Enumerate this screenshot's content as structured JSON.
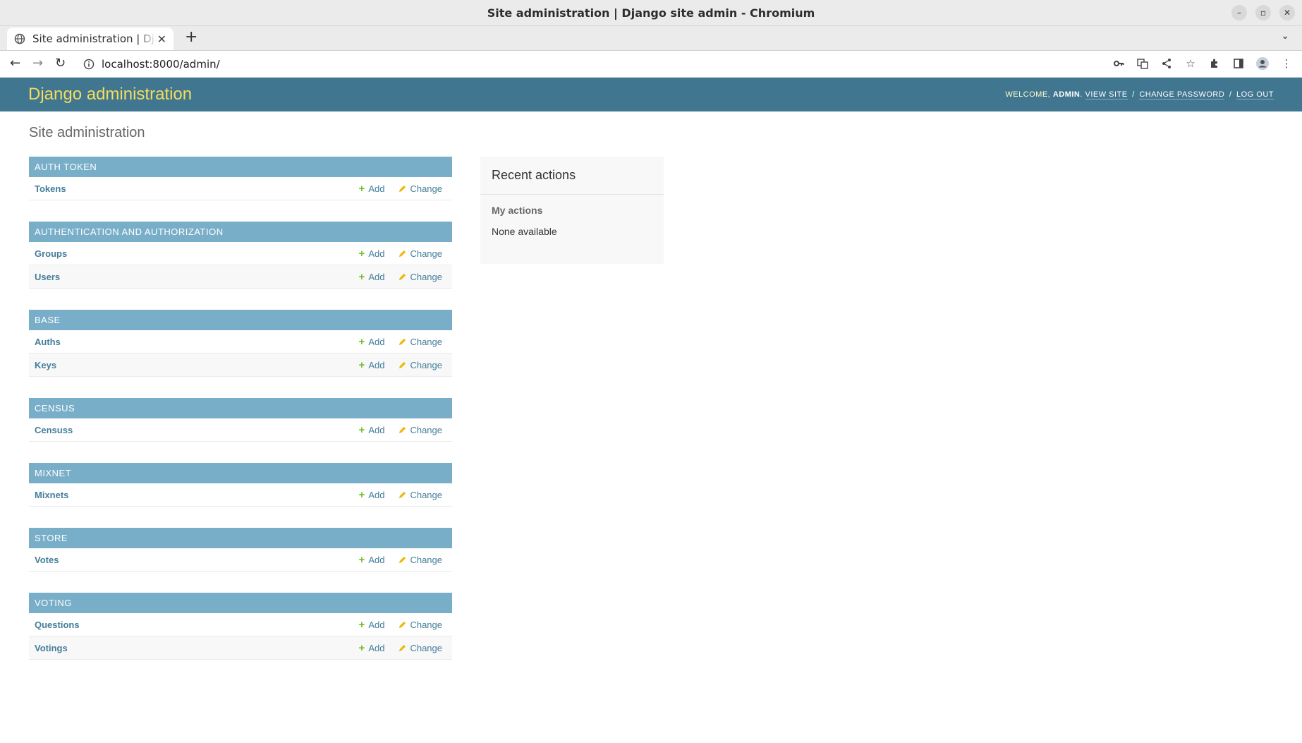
{
  "window": {
    "title": "Site administration | Django site admin - Chromium",
    "controls": [
      "–",
      "▫",
      "✕"
    ]
  },
  "tab": {
    "label": "Site administration | Django site admin",
    "close": "✕",
    "new_tab": "+"
  },
  "toolbar": {
    "url": "localhost:8000/admin/",
    "back": "←",
    "forward": "→",
    "reload": "↻"
  },
  "header": {
    "branding": "Django administration",
    "welcome": "Welcome,",
    "username": "admin",
    "view_site": "View site",
    "change_password": "Change password",
    "log_out": "Log out",
    "sep": "/"
  },
  "page_title": "Site administration",
  "labels": {
    "add": "Add",
    "change": "Change"
  },
  "apps": [
    {
      "name": "Auth Token",
      "models": [
        "Tokens"
      ]
    },
    {
      "name": "Authentication and Authorization",
      "models": [
        "Groups",
        "Users"
      ]
    },
    {
      "name": "Base",
      "models": [
        "Auths",
        "Keys"
      ]
    },
    {
      "name": "Census",
      "models": [
        "Censuss"
      ]
    },
    {
      "name": "Mixnet",
      "models": [
        "Mixnets"
      ]
    },
    {
      "name": "Store",
      "models": [
        "Votes"
      ]
    },
    {
      "name": "Voting",
      "models": [
        "Questions",
        "Votings"
      ]
    }
  ],
  "recent": {
    "title": "Recent actions",
    "subtitle": "My actions",
    "empty": "None available"
  },
  "colors": {
    "header_bg": "#417690",
    "branding": "#f5dd5d",
    "caption_bg": "#79aec8",
    "link": "#447e9b",
    "add_icon": "#70bf2b",
    "change_icon": "#efb80b"
  }
}
